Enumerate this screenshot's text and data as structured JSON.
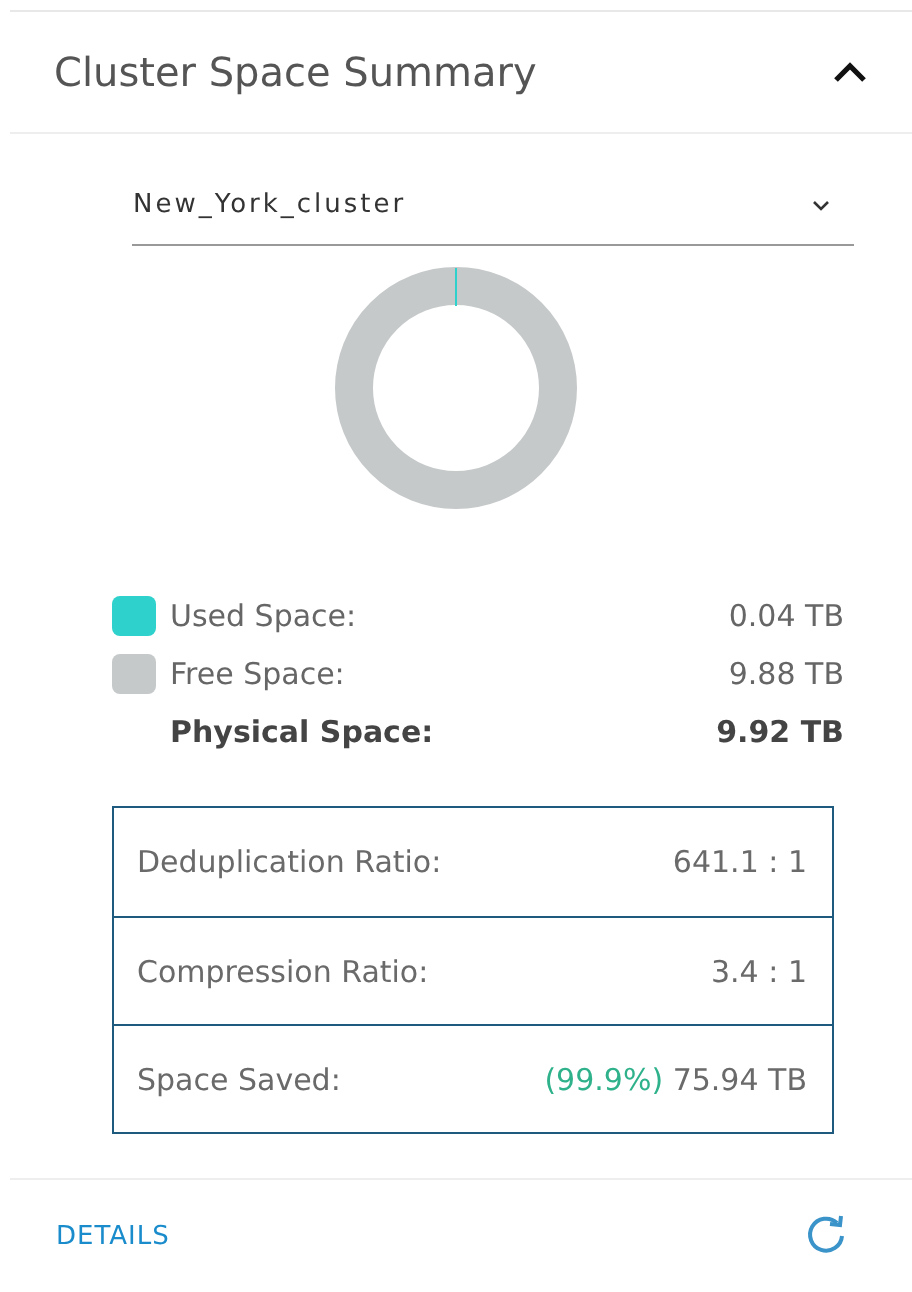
{
  "header": {
    "title": "Cluster Space Summary",
    "expanded": true
  },
  "cluster_select": {
    "value": "New_York_cluster"
  },
  "legend": [
    {
      "label": "Used Space:",
      "value": "0.04 TB",
      "color": "#2ed1cb",
      "kind": "swatch"
    },
    {
      "label": "Free Space:",
      "value": "9.88 TB",
      "color": "#c6c9ca",
      "kind": "swatch"
    },
    {
      "label": "Physical Space:",
      "value": "9.92 TB",
      "kind": "total"
    }
  ],
  "ratios": [
    {
      "label": "Deduplication Ratio:",
      "value": "641.1 : 1"
    },
    {
      "label": "Compression Ratio:",
      "value": "3.4 : 1"
    },
    {
      "label": "Space Saved:",
      "percent": "(99.9%)",
      "value": "75.94 TB"
    }
  ],
  "footer": {
    "link": "DETAILS"
  }
}
